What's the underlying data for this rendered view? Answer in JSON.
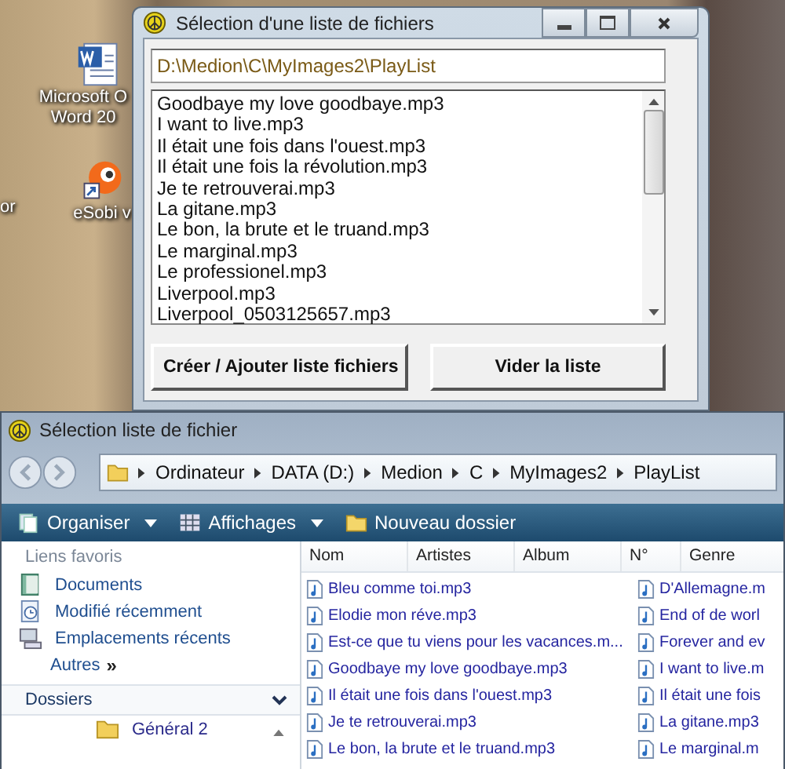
{
  "desktop": {
    "icons": [
      {
        "kind": "word",
        "lines": [
          "Microsoft O",
          "Word 20"
        ]
      },
      {
        "kind": "esobi",
        "lines": [
          "eSobi v"
        ]
      },
      {
        "kind": "none",
        "lines": [
          "or"
        ]
      }
    ]
  },
  "dialog": {
    "title": "Sélection d'une liste de fichiers",
    "path": "D:\\Medion\\C\\MyImages2\\PlayList",
    "files": [
      "Goodbaye my love goodbaye.mp3",
      "I want to live.mp3",
      "Il était une fois dans l'ouest.mp3",
      "Il était une fois la révolution.mp3",
      "Je te retrouverai.mp3",
      "La gitane.mp3",
      "Le bon, la brute et le truand.mp3",
      "Le marginal.mp3",
      "Le professionel.mp3",
      "Liverpool.mp3",
      "Liverpool_0503125657.mp3"
    ],
    "buttons": [
      "Créer / Ajouter liste fichiers",
      "Vider la liste"
    ]
  },
  "explorer": {
    "title": "Sélection liste de fichier",
    "breadcrumb": [
      "Ordinateur",
      "DATA (D:)",
      "Medion",
      "C",
      "MyImages2",
      "PlayList"
    ],
    "toolbar": [
      {
        "kind": "organize",
        "label": "Organiser",
        "dropdown": true
      },
      {
        "kind": "views",
        "label": "Affichages",
        "dropdown": true
      },
      {
        "kind": "folder",
        "label": "Nouveau dossier",
        "dropdown": false
      }
    ],
    "favorites_heading": "Liens favoris",
    "favorites": [
      {
        "kind": "documents",
        "label": "Documents"
      },
      {
        "kind": "recent",
        "label": "Modifié récemment"
      },
      {
        "kind": "places",
        "label": "Emplacements récents"
      }
    ],
    "more": {
      "label": "Autres",
      "chevron": "»"
    },
    "folders_heading": "Dossiers",
    "folders": [
      {
        "label": "Général 2"
      }
    ],
    "columns": [
      "Nom",
      "Artistes",
      "Album",
      "N°",
      "Genre"
    ],
    "files": [
      "Bleu comme toi.mp3",
      "Elodie mon réve.mp3",
      "Est-ce que tu viens pour les vacances.m...",
      "Goodbaye my love goodbaye.mp3",
      "Il était une fois dans l'ouest.mp3",
      "Je te retrouverai.mp3",
      "Le bon, la brute et le truand.mp3",
      "D'Allemagne.m",
      "End of de worl",
      "Forever and ev",
      "I want to live.m",
      "Il était une fois",
      "La gitane.mp3",
      "Le marginal.m"
    ]
  }
}
